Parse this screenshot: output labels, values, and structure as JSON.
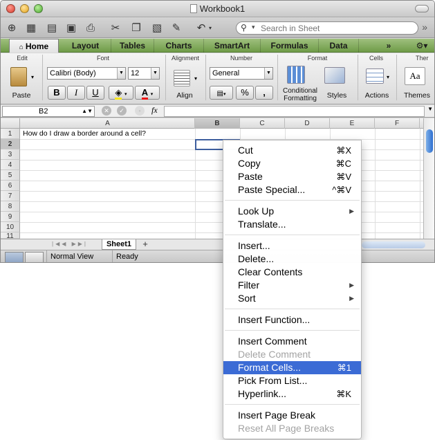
{
  "window": {
    "title": "Workbook1"
  },
  "toolbar": {
    "search_placeholder": "Search in Sheet",
    "icons": [
      "new-workbook-icon",
      "templates-icon",
      "open-icon",
      "save-icon",
      "print-icon",
      "cut-icon",
      "copy-icon",
      "paste-icon",
      "format-painter-icon",
      "undo-icon"
    ]
  },
  "ribbon_tabs": [
    "Home",
    "Layout",
    "Tables",
    "Charts",
    "SmartArt",
    "Formulas",
    "Data"
  ],
  "ribbon": {
    "groups": {
      "edit": "Edit",
      "font": "Font",
      "alignment": "Alignment",
      "number": "Number",
      "format": "Format",
      "cells": "Cells",
      "themes": "Ther"
    },
    "paste_label": "Paste",
    "font_name": "Calibri (Body)",
    "font_size": "12",
    "bold": "B",
    "italic": "I",
    "underline": "U",
    "text_color_label": "A",
    "align_label": "Align",
    "number_format": "General",
    "percent": "%",
    "comma": ",",
    "conditional_formatting": "Conditional\nFormatting",
    "styles_label": "Styles",
    "actions_label": "Actions",
    "themes_label": "Themes",
    "themes_sample": "Aa"
  },
  "formula_bar": {
    "cell_ref": "B2",
    "fx": "fx",
    "value": ""
  },
  "sheet": {
    "columns": [
      "A",
      "B",
      "C",
      "D",
      "E",
      "F"
    ],
    "rows": [
      "1",
      "2",
      "3",
      "4",
      "5",
      "6",
      "7",
      "8",
      "9",
      "10",
      "11"
    ],
    "selected_col": "B",
    "selected_row": "2",
    "cell_a1": "How do I draw a border around a cell?"
  },
  "sheet_tabs": {
    "active": "Sheet1",
    "add": "+"
  },
  "status": {
    "view": "Normal View",
    "state": "Ready"
  },
  "context_menu": {
    "items": [
      {
        "label": "Cut",
        "shortcut": "⌘X"
      },
      {
        "label": "Copy",
        "shortcut": "⌘C"
      },
      {
        "label": "Paste",
        "shortcut": "⌘V"
      },
      {
        "label": "Paste Special...",
        "shortcut": "^⌘V"
      },
      {
        "label": "Look Up",
        "submenu": true
      },
      {
        "label": "Translate..."
      },
      {
        "label": "Insert..."
      },
      {
        "label": "Delete..."
      },
      {
        "label": "Clear Contents"
      },
      {
        "label": "Filter",
        "submenu": true
      },
      {
        "label": "Sort",
        "submenu": true
      },
      {
        "label": "Insert Function..."
      },
      {
        "label": "Insert Comment"
      },
      {
        "label": "Delete Comment",
        "disabled": true
      },
      {
        "label": "Format Cells...",
        "shortcut": "⌘1",
        "highlighted": true
      },
      {
        "label": "Pick From List..."
      },
      {
        "label": "Hyperlink...",
        "shortcut": "⌘K"
      },
      {
        "label": "Insert Page Break"
      },
      {
        "label": "Reset All Page Breaks",
        "disabled": true
      }
    ]
  },
  "colors": {
    "ribbon_tab_green": "#7ea656",
    "menu_highlight": "#3b6bd5",
    "selection_border": "#3d5e9e"
  }
}
